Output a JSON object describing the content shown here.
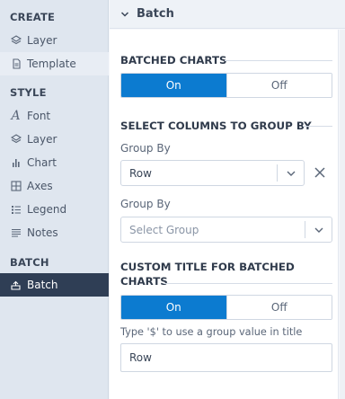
{
  "sidebar": {
    "create_title": "CREATE",
    "create_items": [
      {
        "label": "Layer",
        "icon": "layers-icon"
      },
      {
        "label": "Template",
        "icon": "document-icon"
      }
    ],
    "style_title": "STYLE",
    "style_items": [
      {
        "label": "Font",
        "icon": "font-icon"
      },
      {
        "label": "Layer",
        "icon": "layers-icon"
      },
      {
        "label": "Chart",
        "icon": "bar-chart-icon"
      },
      {
        "label": "Axes",
        "icon": "grid-icon"
      },
      {
        "label": "Legend",
        "icon": "list-icon"
      },
      {
        "label": "Notes",
        "icon": "notes-icon"
      }
    ],
    "batch_title": "BATCH",
    "batch_items": [
      {
        "label": "Batch",
        "icon": "batch-icon",
        "active": true
      }
    ]
  },
  "panel": {
    "header_title": "Batch",
    "batched_charts": {
      "heading": "BATCHED CHARTS",
      "on_label": "On",
      "off_label": "Off",
      "selected": "On"
    },
    "group_by": {
      "heading": "SELECT COLUMNS TO GROUP BY",
      "group1_label": "Group By",
      "group1_value": "Row",
      "group2_label": "Group By",
      "group2_placeholder": "Select Group"
    },
    "custom_title": {
      "heading_line1": "CUSTOM TITLE FOR BATCHED",
      "heading_line2": "CHARTS",
      "on_label": "On",
      "off_label": "Off",
      "selected": "On",
      "hint": "Type '$' to use a group value in title",
      "input_value": "Row"
    }
  },
  "colors": {
    "accent": "#0c7bd0",
    "sidebar_bg": "#dfe6ef",
    "active_bg": "#2f3e55"
  }
}
